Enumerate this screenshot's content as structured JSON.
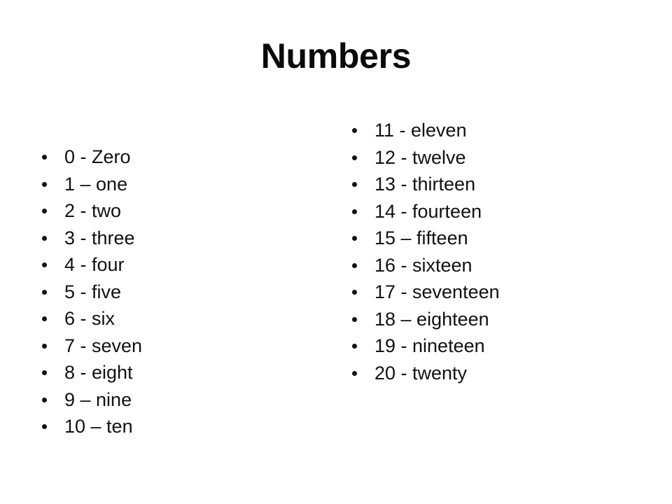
{
  "slide": {
    "title": "Numbers",
    "background_color": "#ffffff",
    "text_color": "#111111",
    "bullet_glyph": "bullet-dot"
  },
  "left_column": {
    "items": [
      {
        "label": "0 - Zero"
      },
      {
        "label": "1 – one"
      },
      {
        "label": "2 - two"
      },
      {
        "label": "3 - three"
      },
      {
        "label": "4 - four"
      },
      {
        "label": "5 - five"
      },
      {
        "label": "6 - six"
      },
      {
        "label": "7 - seven"
      },
      {
        "label": "8 - eight"
      },
      {
        "label": "9 – nine"
      },
      {
        "label": "10 – ten"
      }
    ]
  },
  "right_column": {
    "items": [
      {
        "label": "11 - eleven"
      },
      {
        "label": "12 - twelve"
      },
      {
        "label": "13 - thirteen"
      },
      {
        "label": "14 - fourteen"
      },
      {
        "label": "15 – fifteen"
      },
      {
        "label": "16 - sixteen"
      },
      {
        "label": "17 - seventeen"
      },
      {
        "label": "18 – eighteen"
      },
      {
        "label": "19 - nineteen"
      },
      {
        "label": "20 - twenty"
      }
    ]
  }
}
